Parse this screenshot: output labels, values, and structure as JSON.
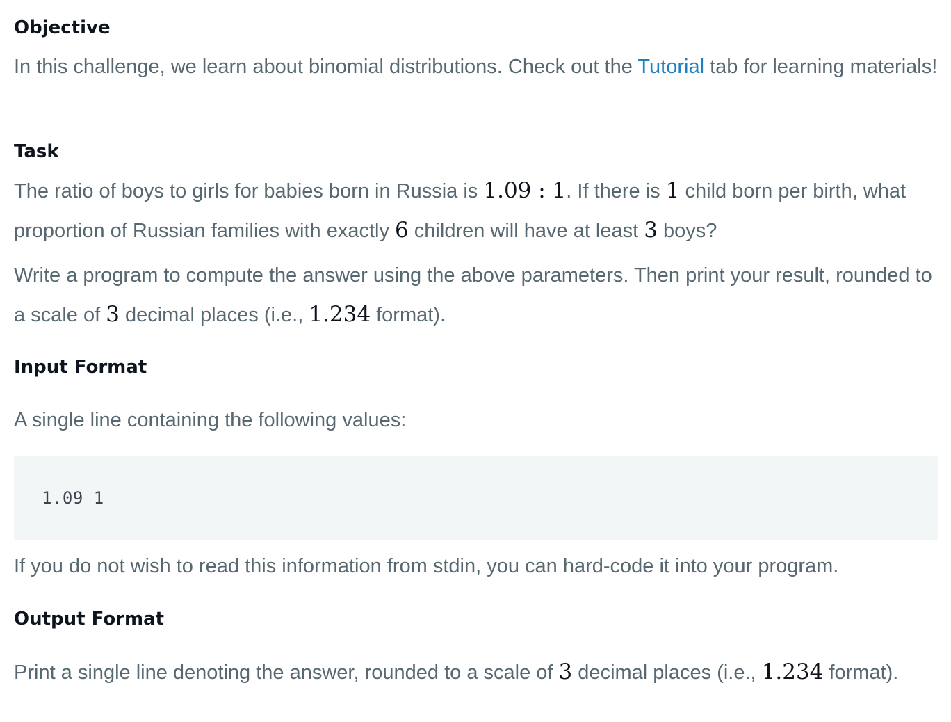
{
  "objective": {
    "heading": "Objective",
    "text_before_link": "In this challenge, we learn about binomial distributions. Check out the ",
    "link_label": "Tutorial",
    "text_after_link": " tab for learning materials!"
  },
  "task": {
    "heading": "Task",
    "p1_a": "The ratio of boys to girls for babies born in Russia is ",
    "p1_math_ratio": "1.09 : 1",
    "p1_b": ". If there is ",
    "p1_math_one": "1",
    "p1_c": " child born per birth, what proportion of Russian families with exactly ",
    "p1_math_six": "6",
    "p1_d": " children will have at least ",
    "p1_math_three": "3",
    "p1_e": " boys?",
    "p2_a": "Write a program to compute the answer using the above parameters. Then print your result, rounded to a scale of ",
    "p2_math_three": "3",
    "p2_b": " decimal places (i.e., ",
    "p2_math_example": "1.234",
    "p2_c": " format)."
  },
  "input_format": {
    "heading": "Input Format",
    "text": "A single line containing the following values:",
    "code": "1.09 1",
    "note": "If you do not wish to read this information from stdin, you can hard-code it into your program."
  },
  "output_format": {
    "heading": "Output Format",
    "text_a": "Print a single line denoting the answer, rounded to a scale of ",
    "math_three": "3",
    "text_b": " decimal places (i.e., ",
    "math_example": "1.234",
    "text_c": " format)."
  }
}
